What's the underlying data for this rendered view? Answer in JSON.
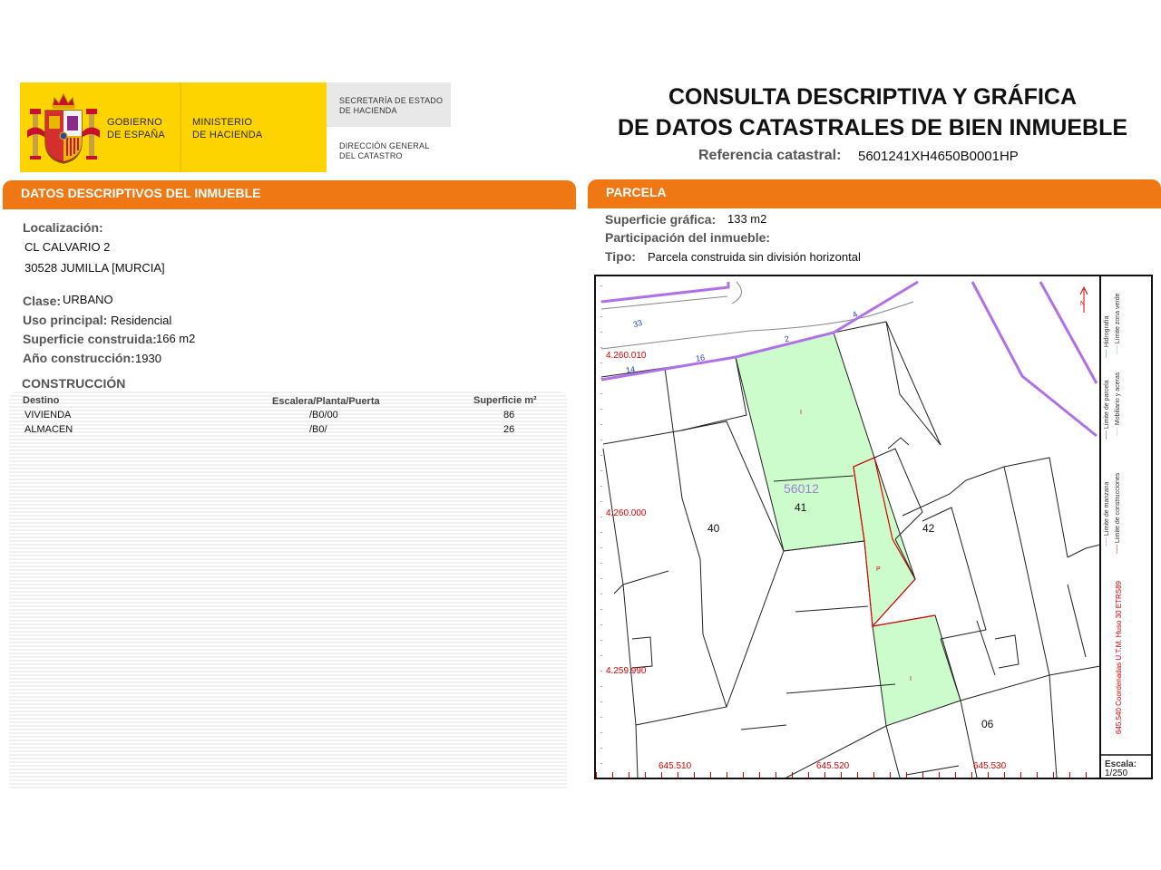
{
  "header": {
    "gobierno": "GOBIERNO\nDE ESPAÑA",
    "ministerio": "MINISTERIO\nDE HACIENDA",
    "secretaria": "SECRETARÍA DE ESTADO\nDE HACIENDA",
    "direccion": "DIRECCIÓN GENERAL\nDEL CATASTRO",
    "title_line1": "CONSULTA DESCRIPTIVA Y GRÁFICA",
    "title_line2": "DE DATOS CATASTRALES DE BIEN INMUEBLE",
    "ref_label": "Referencia catastral:",
    "ref_value": "5601241XH4650B0001HP"
  },
  "colors": {
    "accent": "#f07814",
    "gov_yellow": "#fdd400",
    "parcel_fill": "#ccfccc",
    "coord_red": "#e00000",
    "street_purple": "#b070e8"
  },
  "datos": {
    "section_title": "DATOS DESCRIPTIVOS DEL INMUEBLE",
    "localizacion_label": "Localización:",
    "address_line1": "CL CALVARIO 2",
    "address_line2": "30528 JUMILLA [MURCIA]",
    "clase_label": "Clase:",
    "clase_value": "URBANO",
    "uso_label": "Uso principal:",
    "uso_value": "Residencial",
    "sup_label": "Superficie construida:",
    "sup_value": "166 m2",
    "anio_label": "Año construcción:",
    "anio_value": "1930",
    "construccion_title": "CONSTRUCCIÓN",
    "table": {
      "headers": [
        "Destino",
        "Escalera/Planta/Puerta",
        "Superficie m²"
      ],
      "rows": [
        [
          "VIVIENDA",
          "/B0/00",
          "86"
        ],
        [
          "ALMACEN",
          "/B0/",
          "26"
        ]
      ]
    }
  },
  "parcela": {
    "section_title": "PARCELA",
    "sup_label": "Superficie gráfica:",
    "sup_value": "133 m2",
    "participacion_label": "Participación del inmueble:",
    "tipo_label": "Tipo:",
    "tipo_value": "Parcela construida sin división horizontal"
  },
  "map": {
    "y_coords": [
      "4.260.010",
      "4.260.000",
      "4.259.990"
    ],
    "x_coords": [
      "645.510",
      "645.520",
      "645.530"
    ],
    "street_numbers": [
      "33",
      "14",
      "16",
      "2",
      "4"
    ],
    "parcel_numbers": [
      "40",
      "41",
      "42",
      "06"
    ],
    "block_number": "56012",
    "unit_letters": [
      "I",
      "P",
      "I"
    ],
    "north_label": "N",
    "legend": {
      "hidrografia": "Hidrografía",
      "zona_verde": "Límite zona verde",
      "limite_parcela": "Límite de parcela",
      "mobiliario": "Mobiliario y aceras",
      "limite_manzana": "Límite de manzana",
      "limite_construcciones": "Límite de construcciones",
      "coords_note": "645.540 Coordenadas U.T.M. Huso 30 ETRS89"
    },
    "scale_label": "Escala:",
    "scale_value": "1/250"
  }
}
